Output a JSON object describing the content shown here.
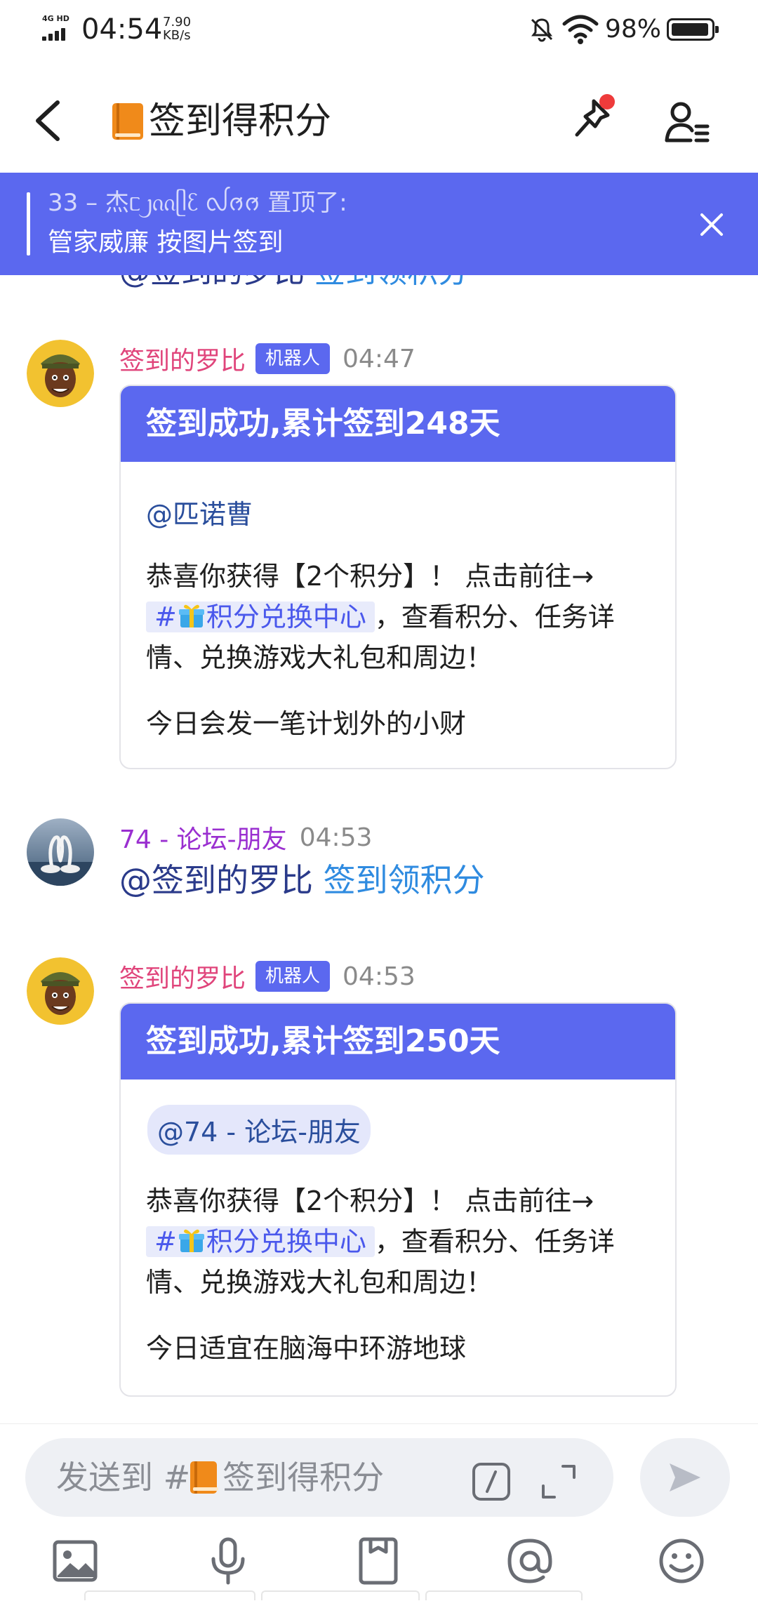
{
  "status_bar": {
    "network": "4G HD",
    "time": "04:54",
    "speed_value": "7.90",
    "speed_unit": "KB/s",
    "battery": "98%"
  },
  "header": {
    "title": "签到得积分",
    "icons": [
      "back-arrow-icon",
      "book-icon",
      "pin-icon",
      "members-icon"
    ]
  },
  "pinned": {
    "line1": "33 – 杰ᥴ᧒ᦶᥫᦷ ᩓᩆᩆ 置顶了:",
    "line2": "管家威廉  按图片签到"
  },
  "prev_message": {
    "mention": "@签到的罗比",
    "link": "签到领积分"
  },
  "messages": [
    {
      "sender": "签到的罗比",
      "badge": "机器人",
      "time": "04:47",
      "card_title": "签到成功,累计签到248天",
      "mention": "@匹诺曹",
      "body_before": "恭喜你获得【2个积分】！ 点击前往→",
      "channel_link": "积分兑换中心",
      "body_after": "，查看积分、任务详情、兑换游戏大礼包和周边！",
      "fortune": "今日会发一笔计划外的小财"
    },
    {
      "sender": "74 - 论坛-朋友",
      "time": "04:53",
      "mention": "@签到的罗比",
      "link": "签到领积分"
    },
    {
      "sender": "签到的罗比",
      "badge": "机器人",
      "time": "04:53",
      "card_title": "签到成功,累计签到250天",
      "mention": "@74 - 论坛-朋友",
      "body_before": "恭喜你获得【2个积分】！ 点击前往→",
      "channel_link": "积分兑换中心",
      "body_after": "，查看积分、任务详情、兑换游戏大礼包和周边！",
      "fortune": "今日适宜在脑海中环游地球"
    }
  ],
  "input": {
    "placeholder_prefix": "发送到 #",
    "placeholder_channel": "签到得积分"
  },
  "toolbar": [
    "image-icon",
    "microphone-icon",
    "card-icon",
    "at-icon",
    "emoji-icon"
  ],
  "colors": {
    "accent": "#5b68ef",
    "bot_name": "#e0457b",
    "user_name": "#9a2fd0",
    "link": "#2f8be0",
    "mention": "#2a4e9c",
    "notification_dot": "#ee3b3b"
  }
}
